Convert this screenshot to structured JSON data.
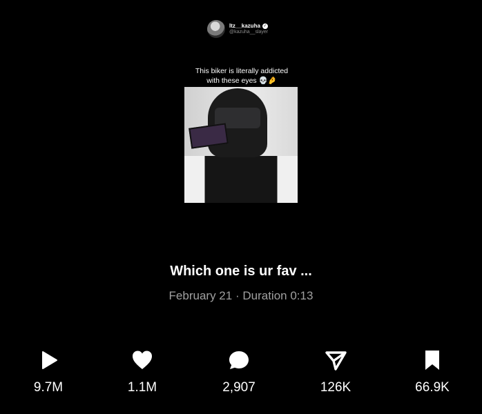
{
  "video": {
    "author_name": "Itz__kazuha",
    "author_handle": "@kazuha__slayer",
    "caption_line1": "This biker is literally addicted",
    "caption_line2": "with these eyes 💀🤌"
  },
  "post": {
    "title": "Which one is ur fav ...",
    "date": "February 21",
    "separator": "·",
    "duration": "Duration 0:13"
  },
  "stats": [
    {
      "icon": "play-icon",
      "value": "9.7M"
    },
    {
      "icon": "heart-icon",
      "value": "1.1M"
    },
    {
      "icon": "comment-icon",
      "value": "2,907"
    },
    {
      "icon": "share-icon",
      "value": "126K"
    },
    {
      "icon": "bookmark-icon",
      "value": "66.9K"
    }
  ]
}
